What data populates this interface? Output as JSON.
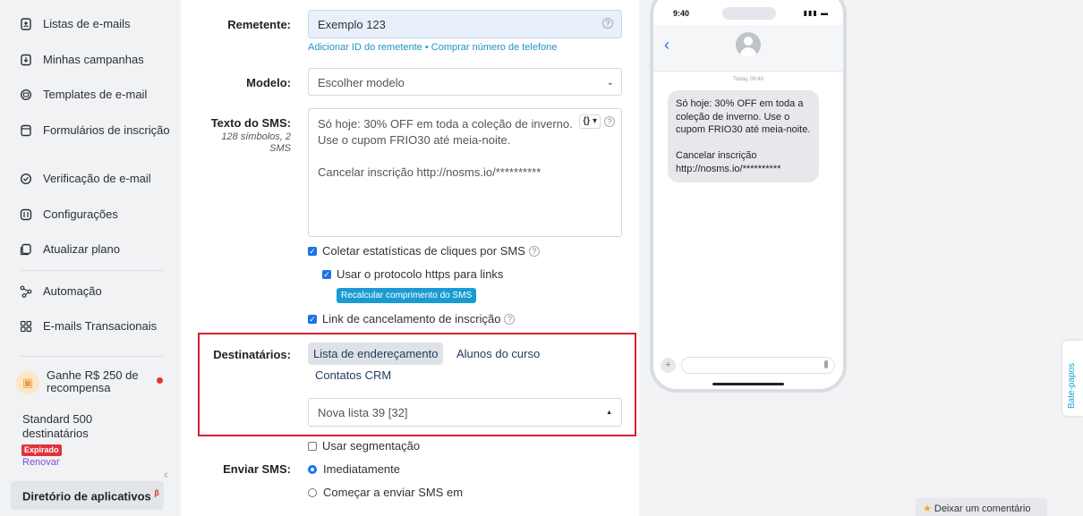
{
  "sidebar": {
    "items": [
      {
        "label": "Listas de e-mails",
        "icon": "contacts-book-icon"
      },
      {
        "label": "Minhas campanhas",
        "icon": "campaign-icon"
      },
      {
        "label": "Templates de e-mail",
        "icon": "template-icon"
      },
      {
        "label": "Formulários de inscrição",
        "icon": "form-icon"
      },
      {
        "label": "Verificação de e-mail",
        "icon": "check-circle-icon"
      },
      {
        "label": "Configurações",
        "icon": "settings-icon"
      },
      {
        "label": "Atualizar plano",
        "icon": "upgrade-icon"
      },
      {
        "label": "Automação",
        "icon": "automation-icon"
      },
      {
        "label": "E-mails Transacionais",
        "icon": "grid-icon"
      }
    ],
    "reward": "Ganhe R$ 250 de recompensa",
    "plan": "Standard 500 destinatários",
    "expired_badge": "Expirado",
    "renew_link": "Renovar",
    "app_directory": "Diretório de aplicativos",
    "app_directory_beta": "β"
  },
  "form": {
    "sender_label": "Remetente:",
    "sender_value": "Exemplo 123",
    "sender_links": "Adicionar ID do remetente • Comprar número de telefone",
    "template_label": "Modelo:",
    "template_value": "Escolher modelo",
    "sms_label": "Texto do SMS:",
    "sms_sublabel": "128 símbolos, 2 SMS",
    "sms_line1": "Só hoje: 30% OFF em toda a coleção de inverno.",
    "sms_line2": "Use o cupom FRIO30 até meia-noite.",
    "sms_line3": "Cancelar inscrição http://nosms.io/**********",
    "variable_button": "{}",
    "collect_clicks": "Coletar estatísticas de cliques por SMS",
    "use_https": "Usar o protocolo https para links",
    "recalc_button": "Recalcular comprimento do SMS",
    "unsubscribe_link": "Link de cancelamento de inscrição",
    "recipients_label": "Destinatários:",
    "tabs": [
      "Lista de endereçamento",
      "Alunos do curso",
      "Contatos CRM"
    ],
    "list_value": "Nova lista 39 [32]",
    "use_segmentation": "Usar segmentação",
    "send_label": "Enviar SMS:",
    "send_now": "Imediatamente",
    "send_later": "Começar a enviar SMS em"
  },
  "phone": {
    "time": "9:40",
    "date": "Today, 09:40",
    "message_line1": "Só hoje: 30% OFF em toda a",
    "message_line2": "coleção de inverno. Use o",
    "message_line3": "cupom FRIO30 até meia-noite.",
    "message_line4": "Cancelar inscrição",
    "message_line5": "http://nosms.io/**********"
  },
  "chats_tab": "Bate-papos",
  "feedback_button": "Deixar um comentário",
  "colors": {
    "accent": "#1a73e8",
    "highlight_border": "#d6202a",
    "expired": "#e0333a"
  }
}
